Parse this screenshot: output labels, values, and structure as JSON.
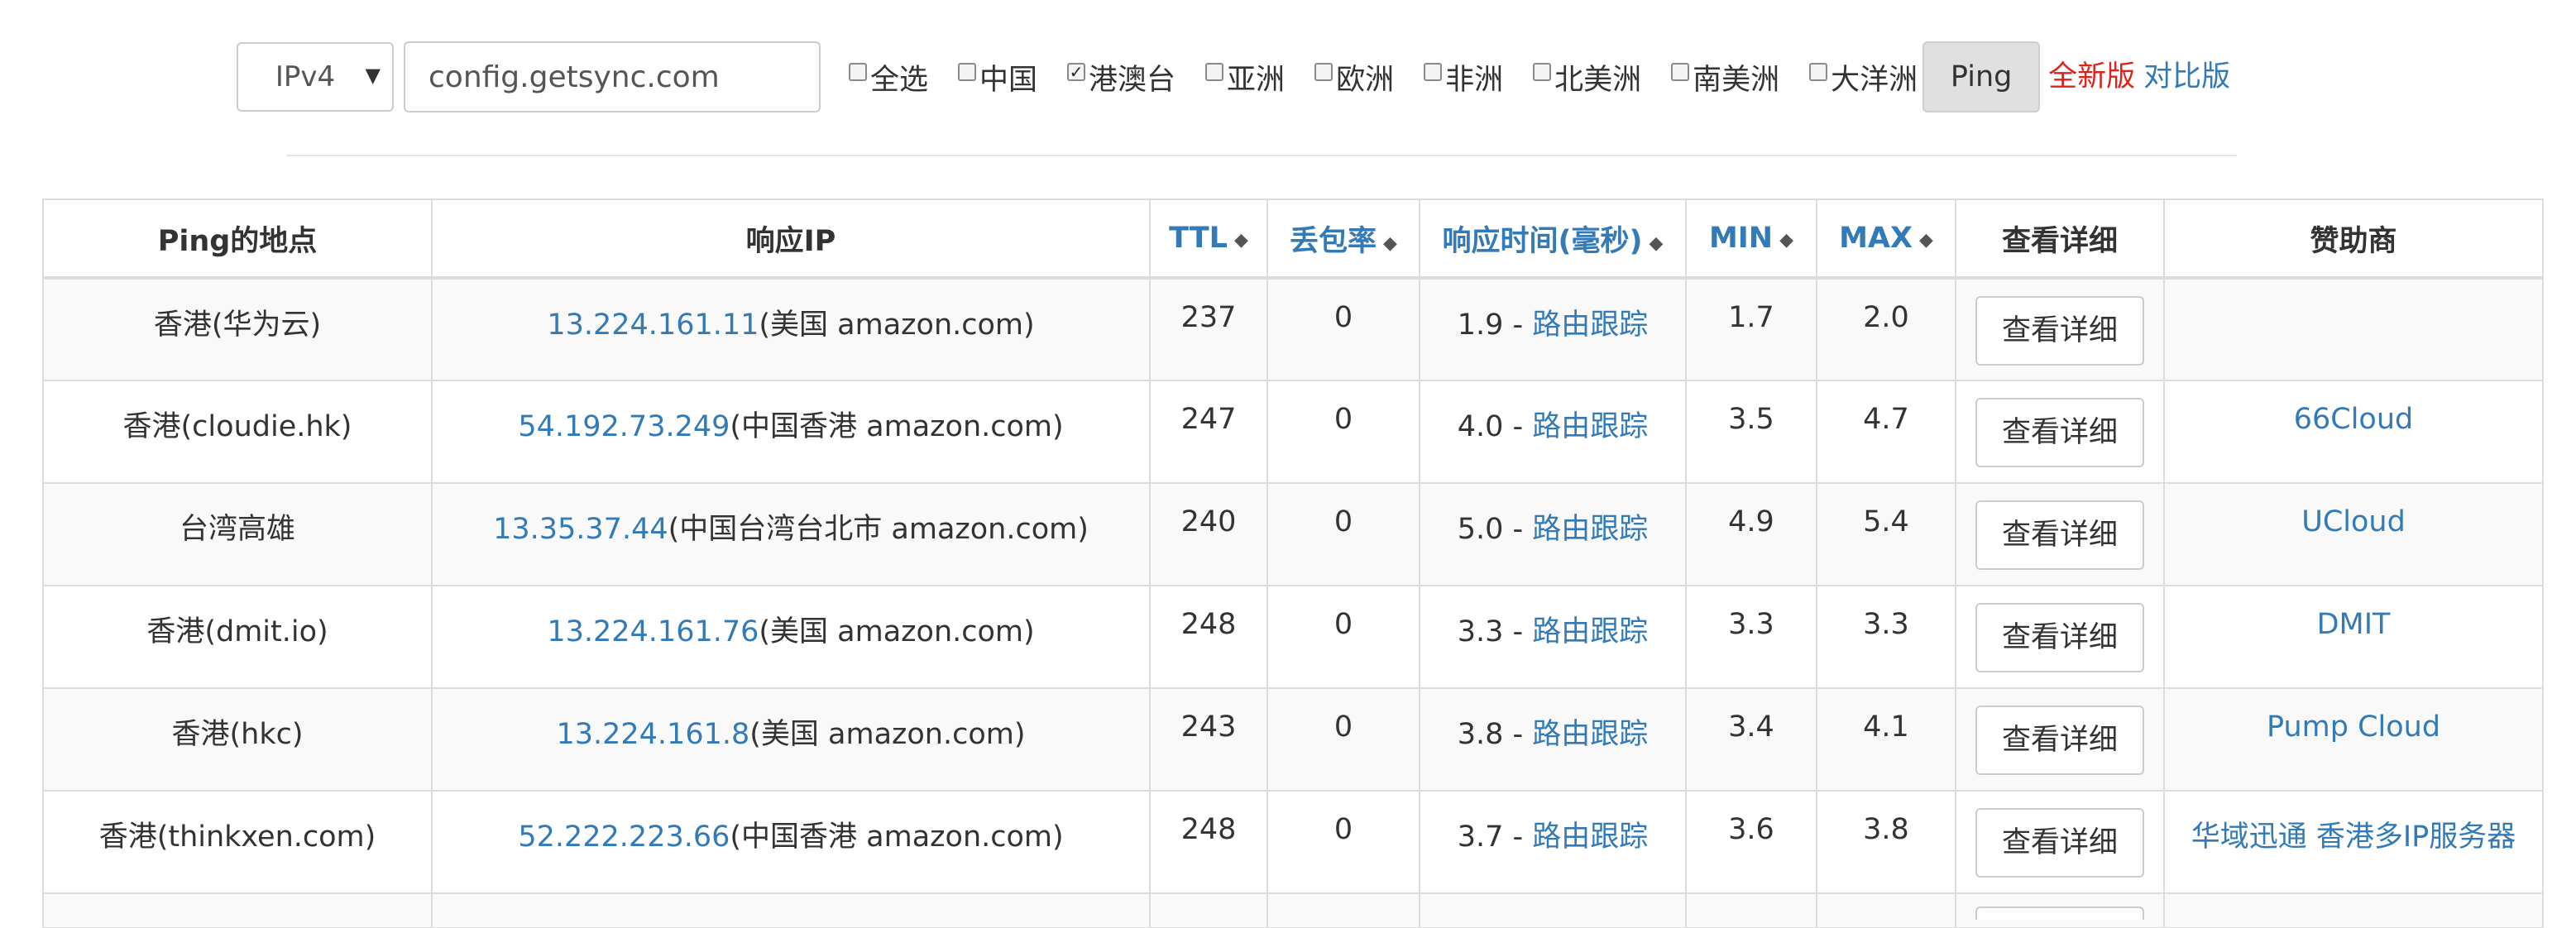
{
  "toolbar": {
    "ip_version": "IPv4",
    "host": "config.getsync.com",
    "regions": [
      {
        "label": "全选",
        "checked": false
      },
      {
        "label": "中国",
        "checked": false
      },
      {
        "label": "港澳台",
        "checked": true
      },
      {
        "label": "亚洲",
        "checked": false
      },
      {
        "label": "欧洲",
        "checked": false
      },
      {
        "label": "非洲",
        "checked": false
      },
      {
        "label": "北美洲",
        "checked": false
      },
      {
        "label": "南美洲",
        "checked": false
      },
      {
        "label": "大洋洲",
        "checked": false
      }
    ],
    "ping_label": "Ping",
    "new_version_label": "全新版",
    "compare_label": "对比版"
  },
  "table": {
    "headers": {
      "location": "Ping的地点",
      "ip": "响应IP",
      "ttl": "TTL",
      "loss": "丢包率",
      "time": "响应时间(毫秒)",
      "min": "MIN",
      "max": "MAX",
      "detail": "查看详细",
      "sponsor": "赞助商"
    },
    "rows": [
      {
        "location": "香港(华为云)",
        "ip": "13.224.161.11",
        "ip_info": "(美国 amazon.com)",
        "ttl": "237",
        "loss": "0",
        "time": "1.9",
        "sep": " - ",
        "trace": "路由跟踪",
        "min": "1.7",
        "max": "2.0",
        "detail": "查看详细",
        "sponsor": ""
      },
      {
        "location": "香港(cloudie.hk)",
        "ip": "54.192.73.249",
        "ip_info": "(中国香港 amazon.com)",
        "ttl": "247",
        "loss": "0",
        "time": "4.0",
        "sep": " - ",
        "trace": "路由跟踪",
        "min": "3.5",
        "max": "4.7",
        "detail": "查看详细",
        "sponsor": "66Cloud"
      },
      {
        "location": "台湾高雄",
        "ip": "13.35.37.44",
        "ip_info": "(中国台湾台北市 amazon.com)",
        "ttl": "240",
        "loss": "0",
        "time": "5.0",
        "sep": " - ",
        "trace": "路由跟踪",
        "min": "4.9",
        "max": "5.4",
        "detail": "查看详细",
        "sponsor": "UCloud"
      },
      {
        "location": "香港(dmit.io)",
        "ip": "13.224.161.76",
        "ip_info": "(美国 amazon.com)",
        "ttl": "248",
        "loss": "0",
        "time": "3.3",
        "sep": " - ",
        "trace": "路由跟踪",
        "min": "3.3",
        "max": "3.3",
        "detail": "查看详细",
        "sponsor": "DMIT"
      },
      {
        "location": "香港(hkc)",
        "ip": "13.224.161.8",
        "ip_info": "(美国 amazon.com)",
        "ttl": "243",
        "loss": "0",
        "time": "3.8",
        "sep": " - ",
        "trace": "路由跟踪",
        "min": "3.4",
        "max": "4.1",
        "detail": "查看详细",
        "sponsor": "Pump Cloud"
      },
      {
        "location": "香港(thinkxen.com)",
        "ip": "52.222.223.66",
        "ip_info": "(中国香港 amazon.com)",
        "ttl": "248",
        "loss": "0",
        "time": "3.7",
        "sep": " - ",
        "trace": "路由跟踪",
        "min": "3.6",
        "max": "3.8",
        "detail": "查看详细",
        "sponsor": "华域迅通 香港多IP服务器"
      }
    ]
  }
}
